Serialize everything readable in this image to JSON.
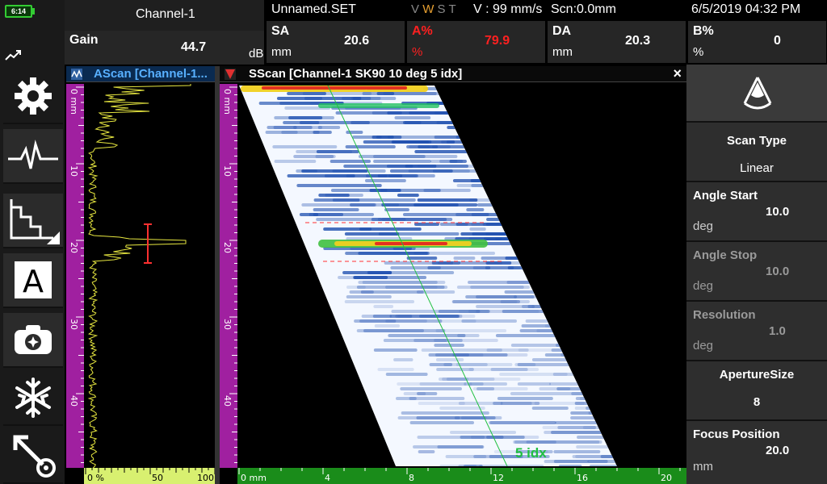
{
  "status": {
    "battery": "6:14",
    "datetime": "6/5/2019 04:32 PM"
  },
  "header": {
    "channel": "Channel-1",
    "setup_file": "Unnamed.SET",
    "mode_letters": [
      "V",
      "W",
      "S",
      "T"
    ],
    "velocity": "V : 99 mm/s",
    "scan_pos": "Scn:0.0mm"
  },
  "measurements": [
    {
      "label": "Gain",
      "value": "44.7",
      "unit": "dB"
    },
    {
      "label": "SA",
      "value": "20.6",
      "unit": "mm"
    },
    {
      "label": "A%",
      "value": "79.9",
      "unit": "%"
    },
    {
      "label": "DA",
      "value": "20.3",
      "unit": "mm"
    },
    {
      "label": "B%",
      "value": "0",
      "unit": "%"
    }
  ],
  "ascan": {
    "title": "AScan [Channel-1...",
    "depth_ticks": [
      "0 mm",
      "10",
      "20",
      "30",
      "40"
    ],
    "amp_ticks": [
      "0 %",
      "50",
      "100"
    ]
  },
  "sscan": {
    "title": "SScan [Channel-1 SK90 10 deg 5 idx]",
    "close": "×",
    "depth_ticks": [
      "0 mm",
      "10",
      "20",
      "30",
      "40"
    ],
    "index_ticks": [
      "0 mm",
      "4",
      "8",
      "12",
      "16",
      "20"
    ],
    "cursor_label": "5 idx"
  },
  "right_panel": {
    "scan_type": {
      "label": "Scan Type",
      "value": "Linear"
    },
    "angle_start": {
      "label": "Angle Start",
      "value": "10.0",
      "unit": "deg"
    },
    "angle_stop": {
      "label": "Angle Stop",
      "value": "10.0",
      "unit": "deg"
    },
    "resolution": {
      "label": "Resolution",
      "value": "1.0",
      "unit": "deg"
    },
    "aperture": {
      "label": "ApertureSize",
      "value": "8"
    },
    "focus": {
      "label": "Focus Position",
      "value": "20.0",
      "unit": "mm"
    }
  },
  "colors": {
    "ruler_v": "#a020a0",
    "ruler_ascan_h": "#d8f070",
    "ruler_sscan_h": "#1a8c1a",
    "ascan_trace": "#e8e840",
    "alarm_red": "#ff2020",
    "gate": "#ff3030",
    "cursor": "#20c040"
  }
}
